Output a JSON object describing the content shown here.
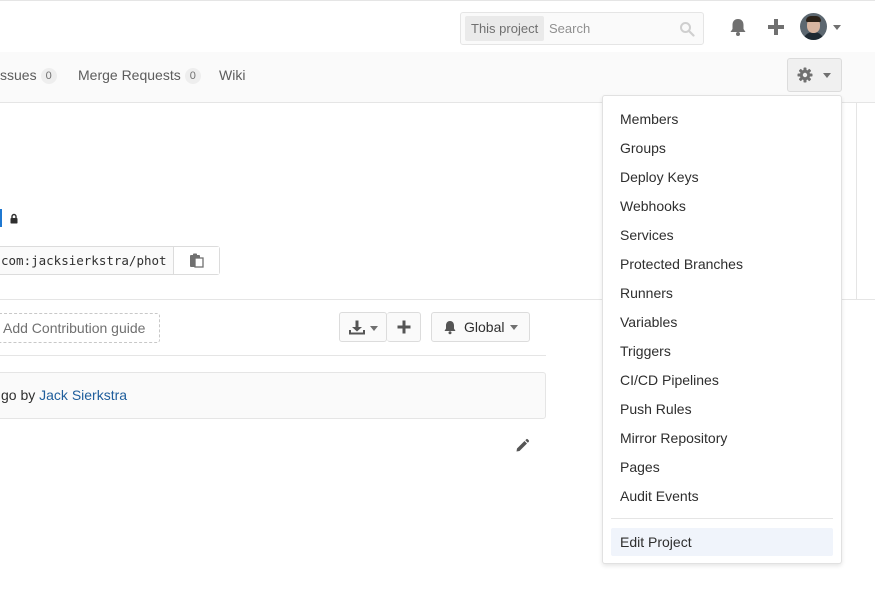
{
  "header": {
    "search": {
      "scope": "This project",
      "placeholder": "Search"
    },
    "icons": [
      "bell-icon",
      "plus-icon",
      "avatar",
      "chevron-down-icon"
    ]
  },
  "subnav": {
    "tabs": [
      {
        "label": "Issues",
        "count": "0"
      },
      {
        "label": "Merge Requests",
        "count": "0"
      },
      {
        "label": "Wiki"
      }
    ],
    "issues_visible": "ssues"
  },
  "project": {
    "clone_url": "com:jacksierkstra/phot"
  },
  "actions": {
    "contribution_label": "Add Contribution guide",
    "notification_label": "Global"
  },
  "commit": {
    "prefix": "go by ",
    "author": "Jack Sierkstra"
  },
  "settings_menu": {
    "items": [
      "Members",
      "Groups",
      "Deploy Keys",
      "Webhooks",
      "Services",
      "Protected Branches",
      "Runners",
      "Variables",
      "Triggers",
      "CI/CD Pipelines",
      "Push Rules",
      "Mirror Repository",
      "Pages",
      "Audit Events"
    ],
    "edit_project": "Edit Project"
  },
  "colors": {
    "link": "#1f5e9c",
    "accent": "#1f78d1",
    "icon": "#707070"
  }
}
